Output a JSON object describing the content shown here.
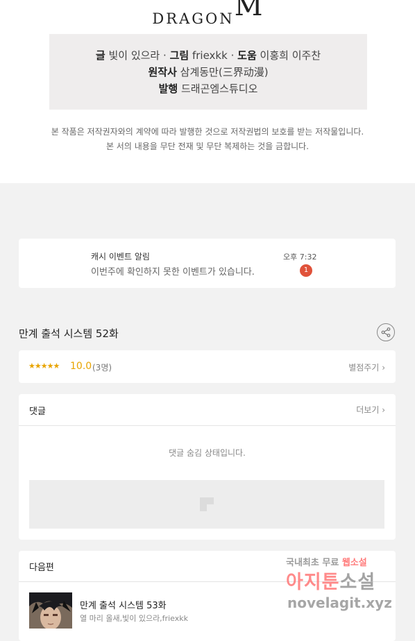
{
  "header": {
    "logo_text": "DRAGON",
    "logo_mark": "M"
  },
  "credits": {
    "line1": [
      {
        "label": "글",
        "value": "빛이 있으라"
      },
      {
        "label": "그림",
        "value": "friexkk"
      },
      {
        "label": "도움",
        "value": "이홍희 이주찬"
      }
    ],
    "separator": "·",
    "original_label": "원작사",
    "original_value": "삼계동만(三界动漫)",
    "publisher_label": "발행",
    "publisher_value": "드래곤엠스튜디오"
  },
  "notice": {
    "line1": "본 작품은 저작권자와의 계약에 따라 발행한 것으로 저작권법의 보호를 받는 저작물입니다.",
    "line2": "본 서의 내용을 무단 전재 및 무단 복제하는 것을 금합니다."
  },
  "event": {
    "title": "캐시 이벤트 알림",
    "message": "이번주에 확인하지 못한 이벤트가 있습니다.",
    "time": "오후 7:32",
    "badge_count": "1"
  },
  "episode": {
    "title": "만계 출석 시스템 52화",
    "share_icon": "share-icon"
  },
  "rating": {
    "stars": "★★★★★",
    "score": "10.0",
    "votes": "(3명)",
    "rate_label": "별점주기",
    "star_color": "#e8a400"
  },
  "comments": {
    "heading": "댓글",
    "more_label": "더보기",
    "hidden_message": "댓글 숨김 상태입니다."
  },
  "next_episode": {
    "heading": "다음편",
    "title": "만계 출석 시스템 53화",
    "authors": "열 마리 올새,빛이 있으라,friexkk"
  },
  "watermark": {
    "line1_pre": "국내최초 무료 ",
    "line1_hl": "웹소설",
    "line2_a": "아지툰",
    "line2_b": "소설",
    "line3": "novelagit.xyz"
  },
  "colors": {
    "badge": "#e0523a",
    "page_bg": "#f2f2f2",
    "credits_bg": "#efeded"
  }
}
